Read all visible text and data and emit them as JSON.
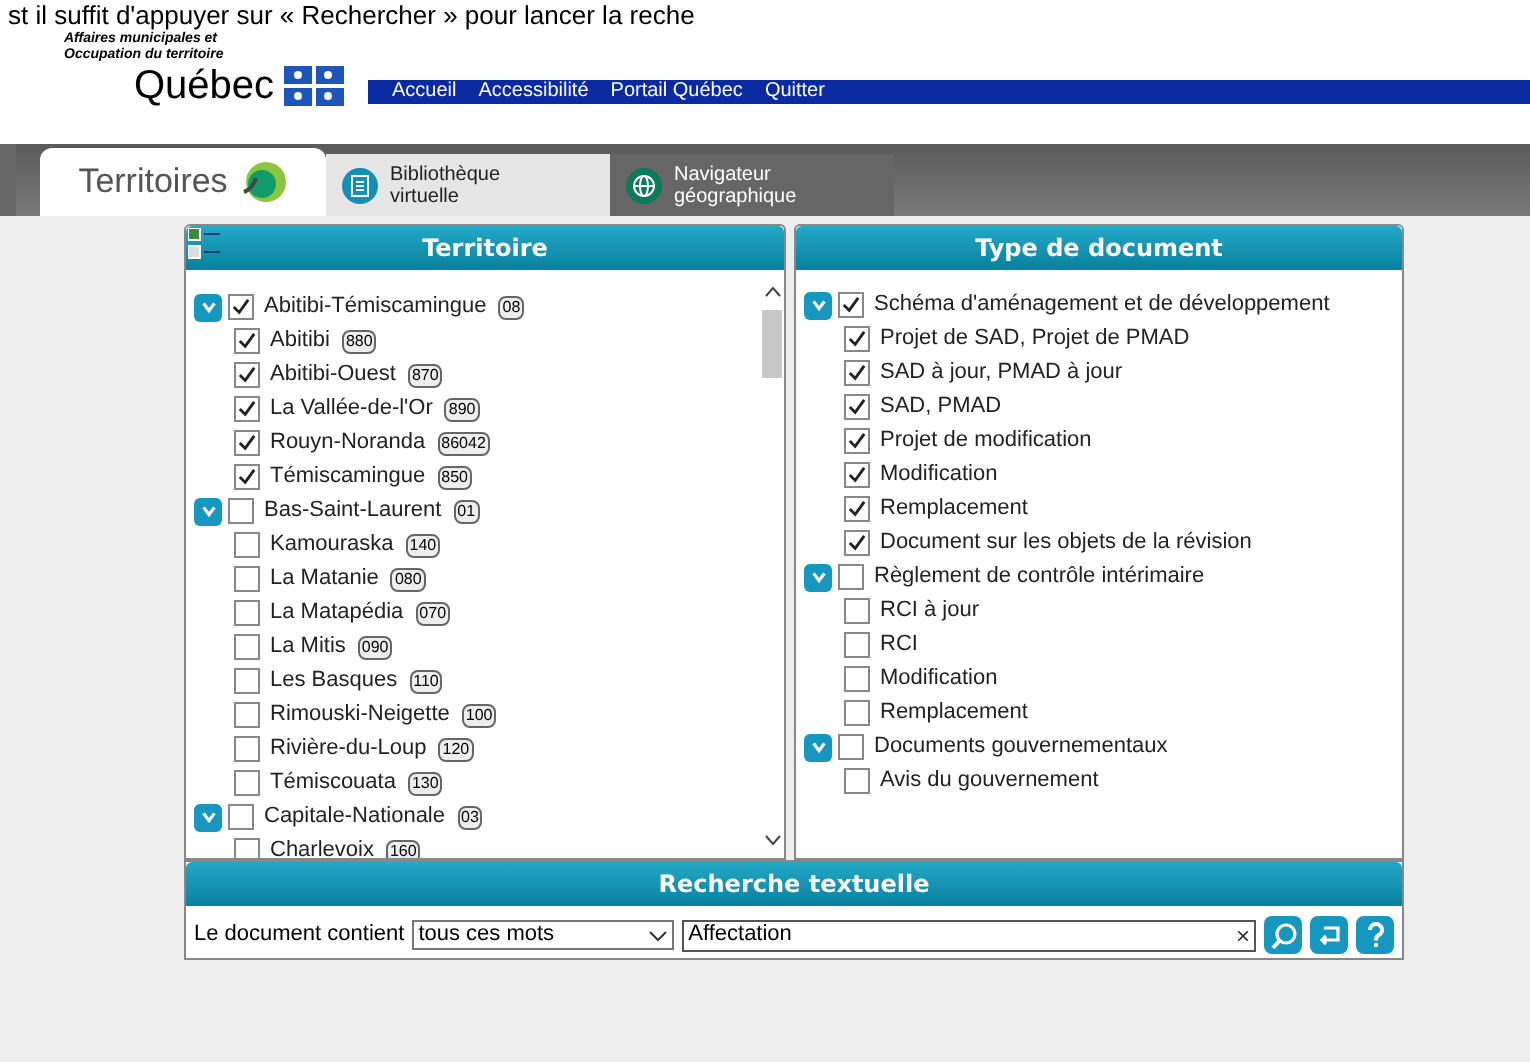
{
  "top_text": "st il suffit d'appuyer sur « Rechercher » pour lancer la reche",
  "ministry": "Affaires municipales et Occupation du territoire",
  "logo_text": "Québec",
  "nav_links": [
    "Accueil",
    "Accessibilité",
    "Portail Québec",
    "Quitter"
  ],
  "app_name": "Territoires",
  "tabs": [
    {
      "label": "Bibliothèque virtuelle",
      "selected": true,
      "kind": "document"
    },
    {
      "label": "Navigateur géographique",
      "selected": false,
      "kind": "globe"
    }
  ],
  "territory_panel": {
    "title": "Territoire",
    "items": [
      {
        "label": "Abitibi-Témiscamingue",
        "code": "08",
        "checked": true,
        "expanded": true,
        "children": [
          {
            "label": "Abitibi",
            "code": "880",
            "checked": true
          },
          {
            "label": "Abitibi-Ouest",
            "code": "870",
            "checked": true
          },
          {
            "label": "La Vallée-de-l'Or",
            "code": "890",
            "checked": true
          },
          {
            "label": "Rouyn-Noranda",
            "code": "86042",
            "checked": true
          },
          {
            "label": "Témiscamingue",
            "code": "850",
            "checked": true
          }
        ]
      },
      {
        "label": "Bas-Saint-Laurent",
        "code": "01",
        "checked": false,
        "expanded": true,
        "children": [
          {
            "label": "Kamouraska",
            "code": "140",
            "checked": false
          },
          {
            "label": "La Matanie",
            "code": "080",
            "checked": false
          },
          {
            "label": "La Matapédia",
            "code": "070",
            "checked": false
          },
          {
            "label": "La Mitis",
            "code": "090",
            "checked": false
          },
          {
            "label": "Les Basques",
            "code": "110",
            "checked": false
          },
          {
            "label": "Rimouski-Neigette",
            "code": "100",
            "checked": false
          },
          {
            "label": "Rivière-du-Loup",
            "code": "120",
            "checked": false
          },
          {
            "label": "Témiscouata",
            "code": "130",
            "checked": false
          }
        ]
      },
      {
        "label": "Capitale-Nationale",
        "code": "03",
        "checked": false,
        "expanded": true,
        "children": [
          {
            "label": "Charlevoix",
            "code": "160",
            "checked": false
          }
        ]
      }
    ]
  },
  "document_panel": {
    "title": "Type de document",
    "items": [
      {
        "label": "Schéma d'aménagement et de développement",
        "checked": true,
        "expanded": true,
        "children": [
          {
            "label": "Projet de SAD, Projet de PMAD",
            "checked": true
          },
          {
            "label": "SAD à jour, PMAD à jour",
            "checked": true
          },
          {
            "label": "SAD, PMAD",
            "checked": true
          },
          {
            "label": "Projet de modification",
            "checked": true
          },
          {
            "label": "Modification",
            "checked": true
          },
          {
            "label": "Remplacement",
            "checked": true
          },
          {
            "label": "Document sur les objets de la révision",
            "checked": true
          }
        ]
      },
      {
        "label": "Règlement de contrôle intérimaire",
        "checked": false,
        "expanded": true,
        "children": [
          {
            "label": "RCI à jour",
            "checked": false
          },
          {
            "label": "RCI",
            "checked": false
          },
          {
            "label": "Modification",
            "checked": false
          },
          {
            "label": "Remplacement",
            "checked": false
          }
        ]
      },
      {
        "label": "Documents gouvernementaux",
        "checked": false,
        "expanded": true,
        "children": [
          {
            "label": "Avis du gouvernement",
            "checked": false
          }
        ]
      }
    ]
  },
  "text_search": {
    "title": "Recherche textuelle",
    "label": "Le document contient",
    "mode": "tous ces mots",
    "value": "Affectation",
    "clear": "×"
  }
}
